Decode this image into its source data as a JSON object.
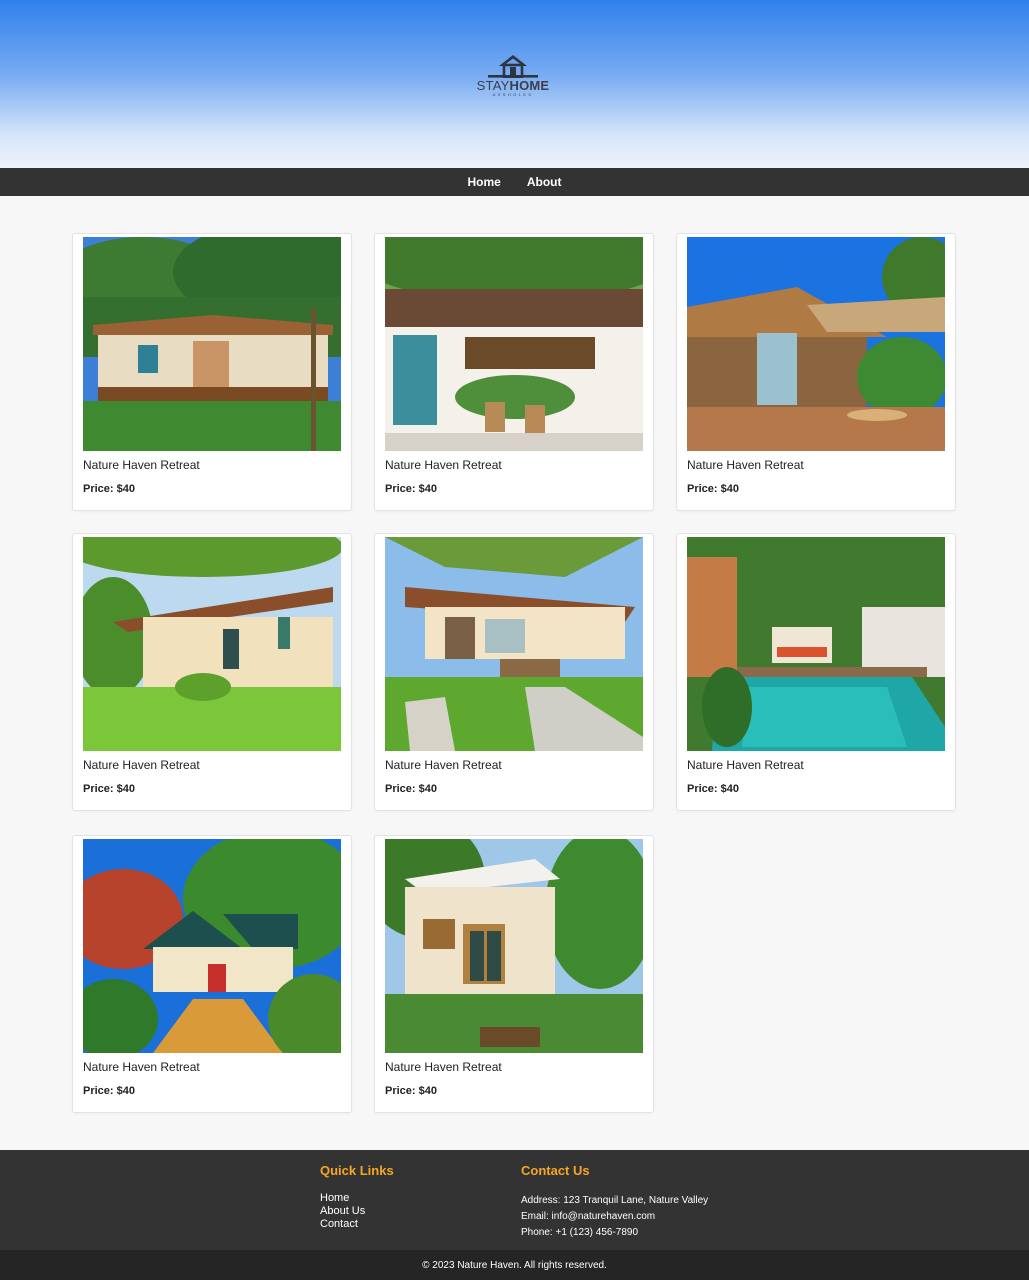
{
  "brand": {
    "logo_word_light": "STAY",
    "logo_word_bold": "HOME",
    "logo_tagline": "ASSHOLES"
  },
  "nav": {
    "items": [
      {
        "label": "Home"
      },
      {
        "label": "About"
      }
    ]
  },
  "listings": [
    {
      "name": "Nature Haven Retreat",
      "price": "Price: $40"
    },
    {
      "name": "Nature Haven Retreat",
      "price": "Price: $40"
    },
    {
      "name": "Nature Haven Retreat",
      "price": "Price: $40"
    },
    {
      "name": "Nature Haven Retreat",
      "price": "Price: $40"
    },
    {
      "name": "Nature Haven Retreat",
      "price": "Price: $40"
    },
    {
      "name": "Nature Haven Retreat",
      "price": "Price: $40"
    },
    {
      "name": "Nature Haven Retreat",
      "price": "Price: $40"
    },
    {
      "name": "Nature Haven Retreat",
      "price": "Price: $40"
    }
  ],
  "footer": {
    "quick_links_title": "Quick Links",
    "quick_links": [
      {
        "label": "Home"
      },
      {
        "label": "About Us"
      },
      {
        "label": "Contact"
      }
    ],
    "contact_title": "Contact Us",
    "address": "Address: 123 Tranquil Lane, Nature Valley",
    "email": "Email: info@naturehaven.com",
    "phone": "Phone: +1 (123) 456-7890",
    "copyright": "© 2023 Nature Haven. All rights reserved."
  },
  "colors": {
    "header_blue": "#2f80ed",
    "nav_bg": "#333333",
    "footer_bg": "#333333",
    "footer_heading": "#f5a623"
  }
}
